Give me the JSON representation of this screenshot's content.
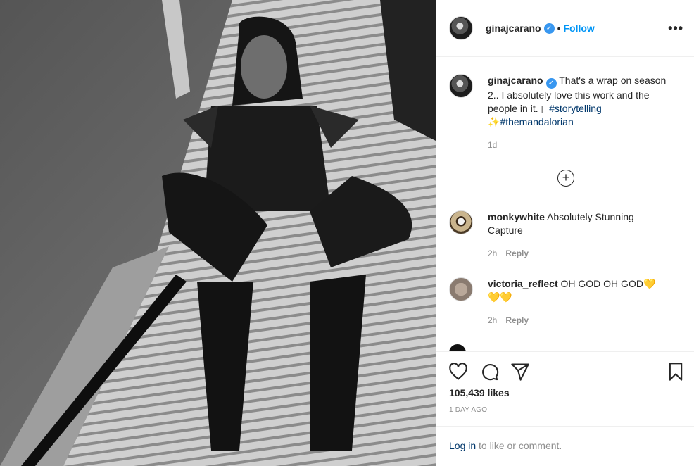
{
  "post": {
    "author": "ginajcarano",
    "verified_glyph": "✓",
    "separator": "•",
    "follow_label": "Follow",
    "more_glyph": "•••"
  },
  "caption": {
    "username": "ginajcarano",
    "text": " That's a wrap on season 2.. I absolutely love this work and the people in it. ",
    "box_glyph": "▯",
    "hashtag1": "#storytelling",
    "sparkle": "✨",
    "hashtag2": "#themandalorian",
    "time": "1d"
  },
  "load_more_glyph": "+",
  "comments": [
    {
      "username": "monkywhite",
      "text": "Absolutely Stunning Capture",
      "time": "2h",
      "reply_label": "Reply"
    },
    {
      "username": "victoria_reflect",
      "text": "OH GOD OH GOD",
      "hearts_inline": "💛",
      "hearts_line2": "💛💛",
      "time": "2h",
      "reply_label": "Reply"
    }
  ],
  "actions": {
    "icons": [
      "heart-icon",
      "comment-icon",
      "share-icon",
      "bookmark-icon"
    ],
    "likes": "105,439 likes",
    "date": "1 DAY AGO"
  },
  "login": {
    "link": "Log in",
    "rest": " to like or comment."
  },
  "colors": {
    "follow": "#0095f6",
    "hashtag": "#00376b",
    "muted": "#8e8e8e",
    "verified": "#3897f0"
  }
}
